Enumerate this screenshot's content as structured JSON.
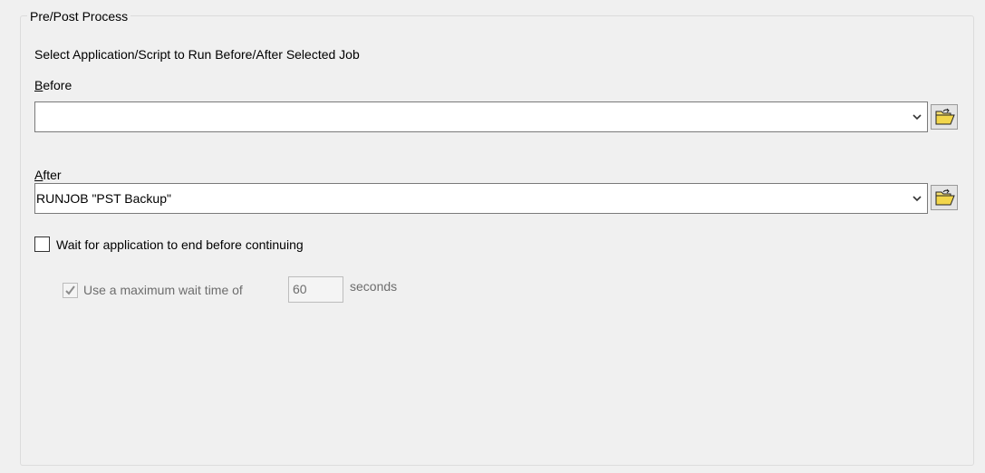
{
  "group": {
    "title": "Pre/Post Process",
    "instruction": "Select Application/Script to Run Before/After Selected Job"
  },
  "before": {
    "label_access_key": "B",
    "label_rest": "efore",
    "value": ""
  },
  "after": {
    "label_access_key": "A",
    "label_rest": "fter",
    "value": "RUNJOB \"PST Backup\""
  },
  "wait": {
    "label": "Wait for application to end before continuing",
    "checked": false
  },
  "max_wait": {
    "label": "Use a maximum wait time of",
    "checked": true,
    "enabled": false,
    "seconds_value": "60",
    "unit": "seconds"
  },
  "icons": {
    "dropdown": "chevron-down-icon",
    "browse": "open-folder-icon"
  },
  "colors": {
    "background": "#f0f0f0",
    "folder_yellow": "#f2d64b",
    "disabled_text": "#6d6d6d"
  }
}
